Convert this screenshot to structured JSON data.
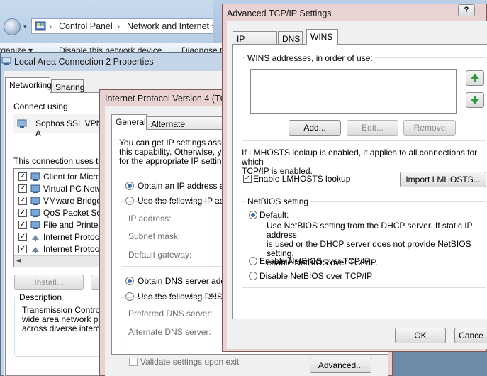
{
  "explorer": {
    "breadcrumb": [
      "Control Panel",
      "Network and Internet"
    ],
    "commands": [
      "Organize ▾",
      "Disable this network device",
      "Diagnose t"
    ]
  },
  "props": {
    "title": "Local Area Connection 2 Properties",
    "tabs": [
      "Networking",
      "Sharing"
    ],
    "connect_using_label": "Connect using:",
    "adapter_name": "Sophos SSL VPN A",
    "uses_label": "This connection uses the",
    "items": [
      "Client for Microso",
      "Virtual PC Netwo",
      "VMware Bridge P",
      "QoS Packet Sch",
      "File and Printer S",
      "Internet Protocol",
      "Internet Protocol"
    ],
    "install_label": "Install...",
    "description_label": "Description",
    "description_text": [
      "Transmission Control P",
      "wide area network proto",
      "across diverse intercon"
    ]
  },
  "ipv4": {
    "title": "Internet Protocol Version 4 (TC",
    "tabs": [
      "General",
      "Alternate Configurati"
    ],
    "intro": [
      "You can get IP settings assign",
      "this capability. Otherwise, you",
      "for the appropriate IP settings"
    ],
    "obtain_ip": "Obtain an IP address aut",
    "use_ip": "Use the following IP add",
    "ip_address": "IP address:",
    "subnet_mask": "Subnet mask:",
    "default_gateway": "Default gateway:",
    "obtain_dns": "Obtain DNS server addre",
    "use_dns": "Use the following DNS se",
    "preferred_dns": "Preferred DNS server:",
    "alternate_dns": "Alternate DNS server:",
    "validate": "Validate settings upon exit",
    "advanced_label": "Advanced..."
  },
  "adv": {
    "title": "Advanced TCP/IP Settings",
    "help_label": "?",
    "tabs": [
      "IP Settings",
      "DNS",
      "WINS"
    ],
    "wins_label": "WINS addresses, in order of use:",
    "add_label": "Add...",
    "edit_label": "Edit...",
    "remove_label": "Remove",
    "lmhosts_info": [
      "If LMHOSTS lookup is enabled, it applies to all connections for which",
      "TCP/IP is enabled."
    ],
    "enable_lmhosts": "Enable LMHOSTS lookup",
    "import_label": "Import LMHOSTS...",
    "netbios_label": "NetBIOS setting",
    "default_label": "Default:",
    "default_desc": [
      "Use NetBIOS setting from the DHCP server. If static IP address",
      "is used or the DHCP server does not provide NetBIOS setting,",
      "enable NetBIOS over TCP/IP."
    ],
    "enable_netbios": "Enable NetBIOS over TCP/IP",
    "disable_netbios": "Disable NetBIOS over TCP/IP",
    "ok_label": "OK",
    "cancel_label": "Cance"
  },
  "colors": {
    "accent": "#3a6ea5",
    "arrow_green": "#2f9a3c"
  }
}
